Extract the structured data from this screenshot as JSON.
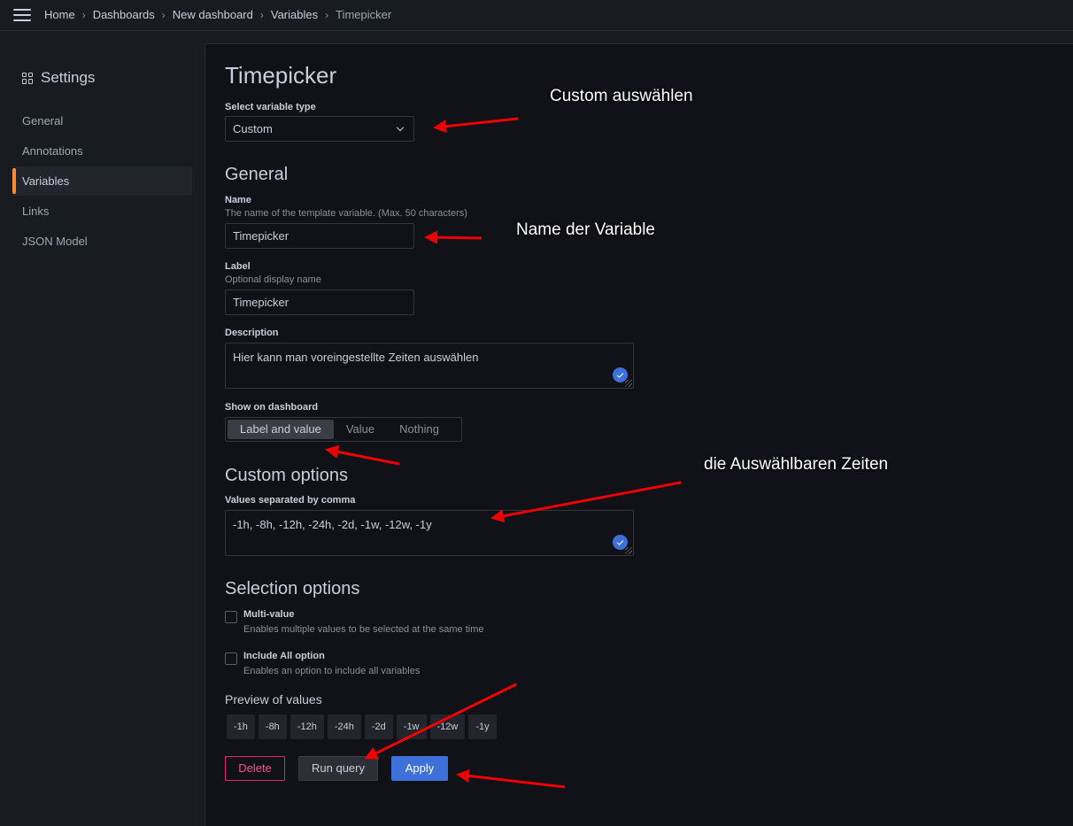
{
  "breadcrumb": [
    "Home",
    "Dashboards",
    "New dashboard",
    "Variables",
    "Timepicker"
  ],
  "sidebar": {
    "title": "Settings",
    "items": [
      {
        "label": "General"
      },
      {
        "label": "Annotations"
      },
      {
        "label": "Variables",
        "active": true
      },
      {
        "label": "Links"
      },
      {
        "label": "JSON Model"
      }
    ]
  },
  "form": {
    "title": "Timepicker",
    "variable_type_label": "Select variable type",
    "variable_type_value": "Custom",
    "general_heading": "General",
    "name_label": "Name",
    "name_desc": "The name of the template variable. (Max. 50 characters)",
    "name_value": "Timepicker",
    "label_label": "Label",
    "label_desc": "Optional display name",
    "label_value": "Timepicker",
    "description_label": "Description",
    "description_value": "Hier kann man voreingestellte Zeiten auswählen",
    "show_label": "Show on dashboard",
    "show_options": [
      "Label and value",
      "Value",
      "Nothing"
    ],
    "show_selected": "Label and value",
    "custom_heading": "Custom options",
    "values_label": "Values separated by comma",
    "values_value": "-1h, -8h, -12h, -24h, -2d, -1w, -12w, -1y",
    "selection_heading": "Selection options",
    "multi_label": "Multi-value",
    "multi_desc": "Enables multiple values to be selected at the same time",
    "include_all_label": "Include All option",
    "include_all_desc": "Enables an option to include all variables",
    "preview_label": "Preview of values",
    "preview_values": [
      "-1h",
      "-8h",
      "-12h",
      "-24h",
      "-2d",
      "-1w",
      "-12w",
      "-1y"
    ]
  },
  "buttons": {
    "delete": "Delete",
    "run_query": "Run query",
    "apply": "Apply"
  },
  "annotations": {
    "custom": "Custom auswählen",
    "name": "Name der Variable",
    "times": "die Auswählbaren Zeiten"
  },
  "colors": {
    "accent_active": "#ff8833",
    "primary": "#3d71d9",
    "danger": "#e0226e",
    "arrow": "#ee0000"
  }
}
